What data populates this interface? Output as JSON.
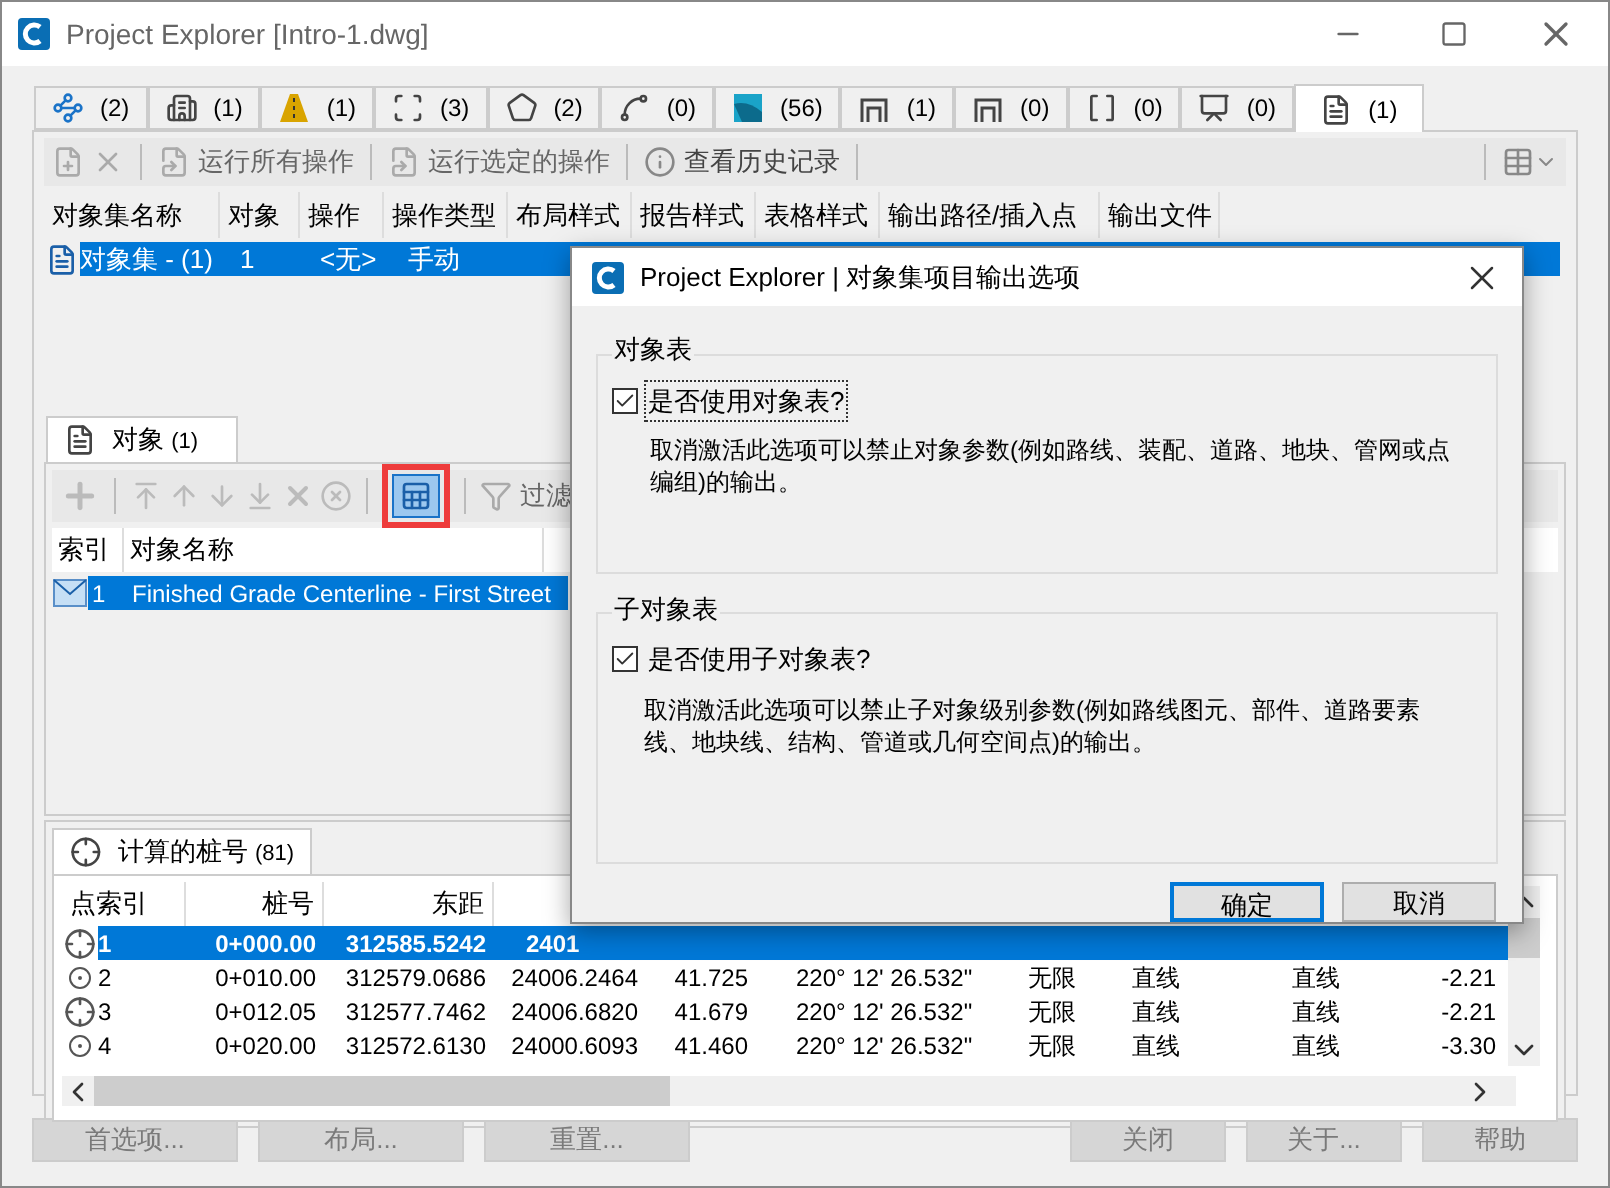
{
  "window": {
    "title": "Project Explorer [Intro-1.dwg]"
  },
  "tabs": [
    {
      "count": "(2)",
      "selected": false
    },
    {
      "count": "(1)",
      "selected": false
    },
    {
      "count": "(1)",
      "selected": false
    },
    {
      "count": "(3)",
      "selected": false
    },
    {
      "count": "(2)",
      "selected": false
    },
    {
      "count": "(0)",
      "selected": false
    },
    {
      "count": "(56)",
      "selected": false
    },
    {
      "count": "(1)",
      "selected": false
    },
    {
      "count": "(0)",
      "selected": false
    },
    {
      "count": "(0)",
      "selected": false
    },
    {
      "count": "(0)",
      "selected": false
    },
    {
      "count": "(1)",
      "selected": true
    }
  ],
  "toolbar": {
    "actions": [
      "运行所有操作",
      "运行选定的操作",
      "查看历史记录"
    ]
  },
  "object_sets": {
    "columns": [
      "对象集名称",
      "对象",
      "操作",
      "操作类型",
      "布局样式",
      "报告样式",
      "表格样式",
      "输出路径/插入点",
      "输出文件"
    ],
    "rows": [
      {
        "selected": true,
        "cells": [
          "对象集 - (1)",
          "1",
          "<无>",
          "手动"
        ]
      }
    ]
  },
  "objects_panel": {
    "tab": {
      "label": "对象",
      "count": "(1)"
    },
    "table_button_active": true,
    "table_button_highlighted": true,
    "filter_label": "过滤",
    "columns": [
      "索引",
      "对象名称"
    ],
    "rows": [
      {
        "selected": true,
        "cells": [
          "1",
          "Finished Grade Centerline - First Street"
        ]
      }
    ]
  },
  "stations_panel": {
    "tab": {
      "label": "计算的桩号",
      "count": "(81)"
    },
    "columns": [
      "点索引",
      "桩号",
      "东距"
    ],
    "rows": [
      {
        "kind": "crosshair",
        "selected": true,
        "cells": [
          "1",
          "0+000.00",
          "312585.5242",
          "2401"
        ]
      },
      {
        "kind": "target",
        "selected": false,
        "cells": [
          "2",
          "0+010.00",
          "312579.0686",
          "24006.2464",
          "41.725",
          "220° 12' 26.532\"",
          "无限",
          "直线",
          "直线",
          "-2.21"
        ]
      },
      {
        "kind": "crosshair",
        "selected": false,
        "cells": [
          "3",
          "0+012.05",
          "312577.7462",
          "24006.6820",
          "41.679",
          "220° 12' 26.532\"",
          "无限",
          "直线",
          "直线",
          "-2.21"
        ]
      },
      {
        "kind": "target",
        "selected": false,
        "cells": [
          "4",
          "0+020.00",
          "312572.6130",
          "24000.6093",
          "41.460",
          "220° 12' 26.532\"",
          "无限",
          "直线",
          "直线",
          "-3.30"
        ]
      }
    ]
  },
  "footer_buttons": [
    {
      "label": "首选项...",
      "disabled": true
    },
    {
      "label": "布局...",
      "disabled": true
    },
    {
      "label": "重置...",
      "disabled": true
    },
    {
      "label": "关闭",
      "disabled": true
    },
    {
      "label": "关于...",
      "disabled": true
    },
    {
      "label": "帮助",
      "disabled": true
    }
  ],
  "dialog": {
    "title": "Project Explorer | 对象集项目输出选项",
    "groups": [
      {
        "title": "对象表",
        "checkbox": {
          "label": "是否使用对象表?",
          "checked": true,
          "focused": true
        },
        "description": "取消激活此选项可以禁止对象参数(例如路线、装配、道路、地块、管网或点编组)的输出。"
      },
      {
        "title": "子对象表",
        "checkbox": {
          "label": "是否使用子对象表?",
          "checked": true,
          "focused": false
        },
        "description": "取消激活此选项可以禁止子对象级别参数(例如路线图元、部件、道路要素线、地块线、结构、管道或几何空间点)的输出。"
      }
    ],
    "buttons": [
      {
        "label": "确定",
        "default": true
      },
      {
        "label": "取消",
        "default": false
      }
    ]
  }
}
